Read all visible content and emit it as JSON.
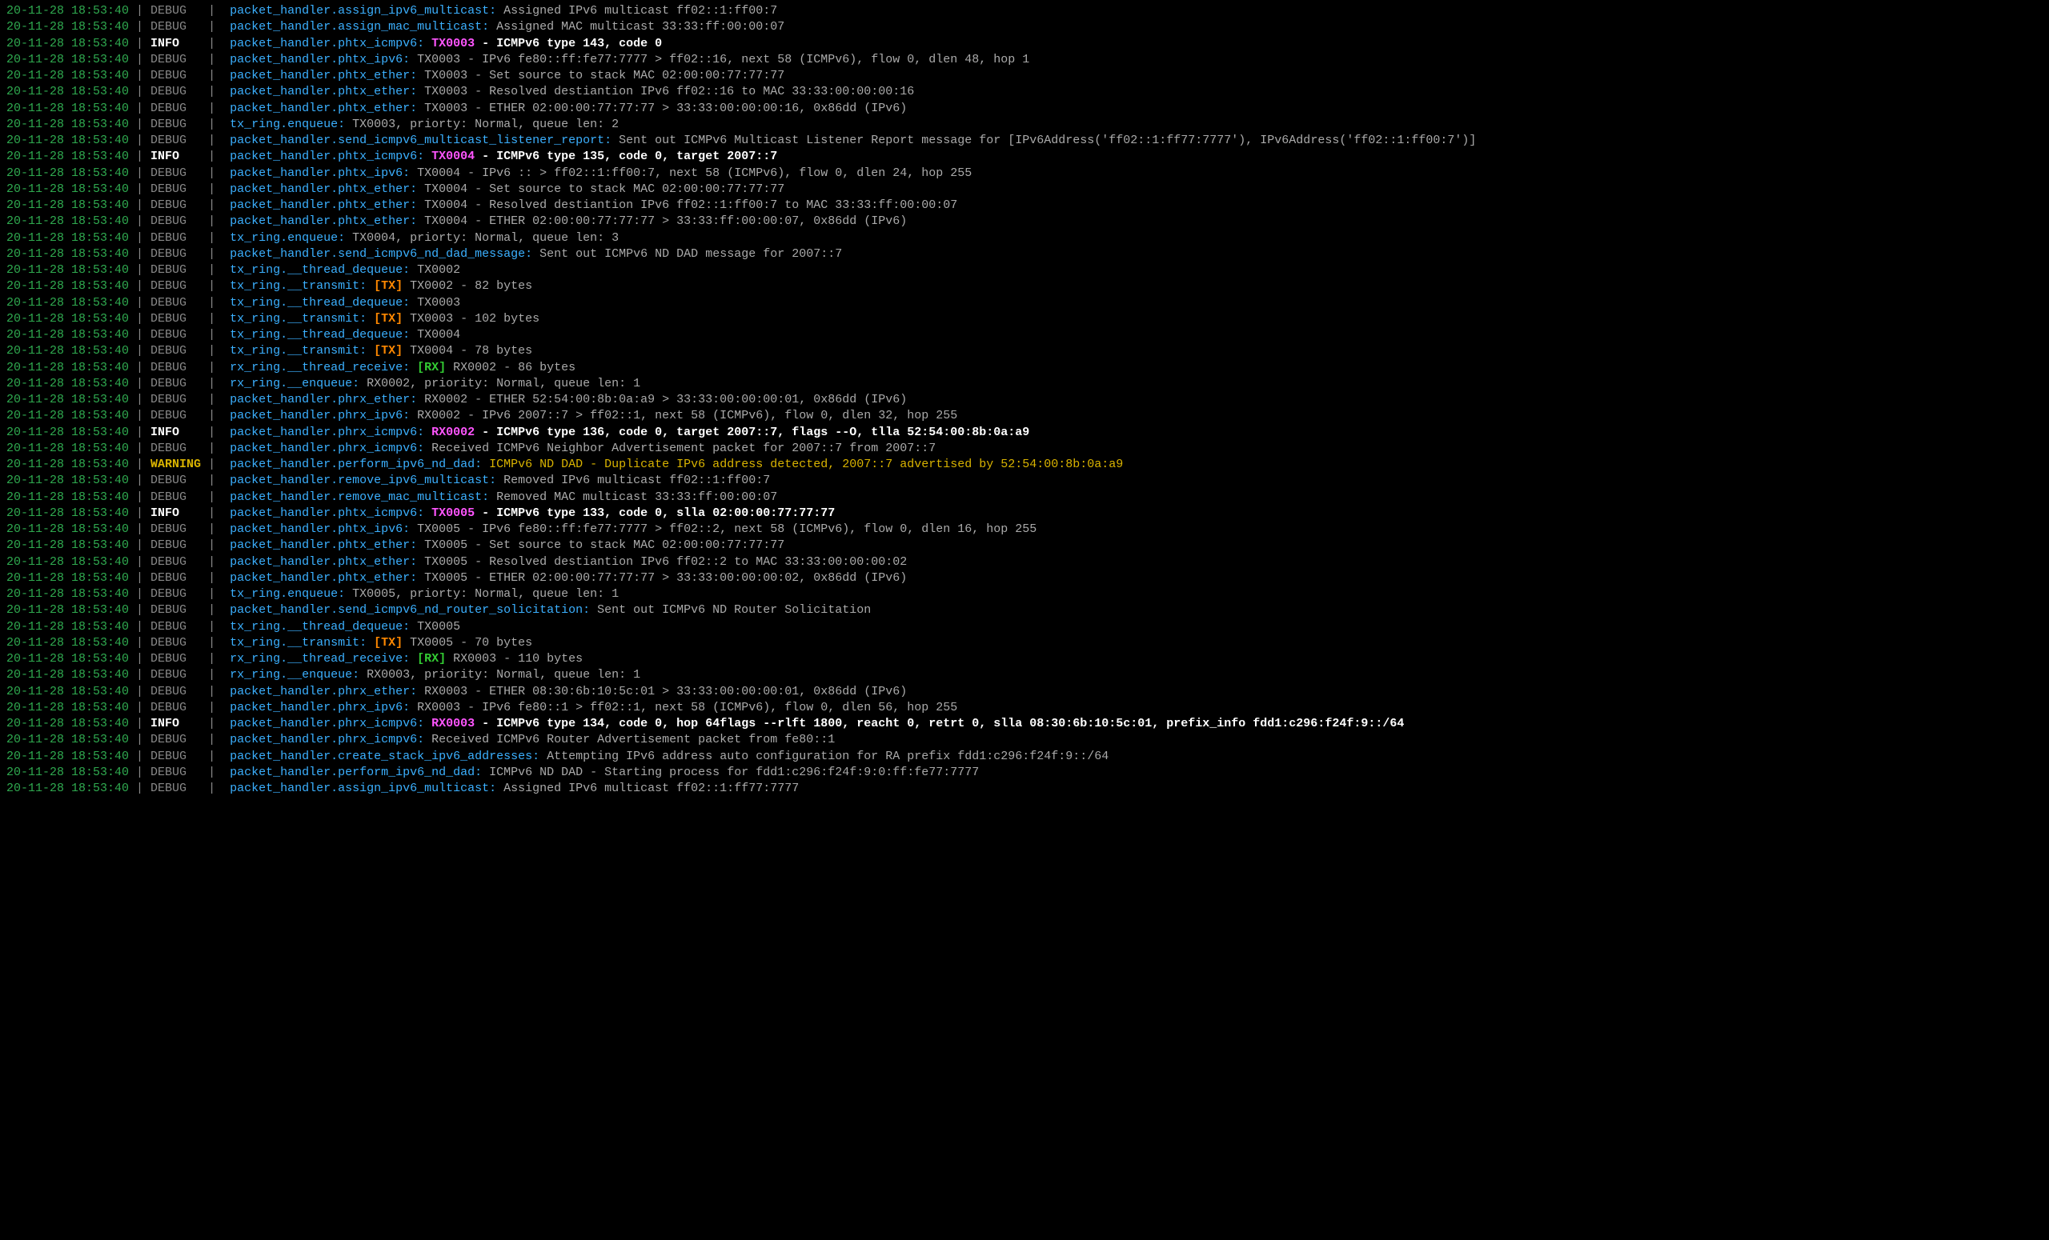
{
  "colors": {
    "timestamp": "#2fa94f",
    "separator": "#888888",
    "level_debug": "#888888",
    "level_info": "#ffffff",
    "level_warning": "#d9b300",
    "source": "#3bb0ff",
    "message": "#aaaaaa",
    "txid": "#ff55ff",
    "txtag": "#ff8800",
    "rxtag": "#33cc33",
    "background": "#000000"
  },
  "lines": [
    {
      "ts": "20-11-28 18:53:40",
      "level": "DEBUG",
      "src": "packet_handler.assign_ipv6_multicast:",
      "msg": "Assigned IPv6 multicast ff02::1:ff00:7"
    },
    {
      "ts": "20-11-28 18:53:40",
      "level": "DEBUG",
      "src": "packet_handler.assign_mac_multicast:",
      "msg": "Assigned MAC multicast 33:33:ff:00:00:07"
    },
    {
      "ts": "20-11-28 18:53:40",
      "level": "INFO",
      "src": "packet_handler.phtx_icmpv6:",
      "txid": "TX0003",
      "msg": " - ICMPv6 type 143, code 0"
    },
    {
      "ts": "20-11-28 18:53:40",
      "level": "DEBUG",
      "src": "packet_handler.phtx_ipv6:",
      "msg": "TX0003 - IPv6 fe80::ff:fe77:7777 > ff02::16, next 58 (ICMPv6), flow 0, dlen 48, hop 1"
    },
    {
      "ts": "20-11-28 18:53:40",
      "level": "DEBUG",
      "src": "packet_handler.phtx_ether:",
      "msg": "TX0003 - Set source to stack MAC 02:00:00:77:77:77"
    },
    {
      "ts": "20-11-28 18:53:40",
      "level": "DEBUG",
      "src": "packet_handler.phtx_ether:",
      "msg": "TX0003 - Resolved destiantion IPv6 ff02::16 to MAC 33:33:00:00:00:16"
    },
    {
      "ts": "20-11-28 18:53:40",
      "level": "DEBUG",
      "src": "packet_handler.phtx_ether:",
      "msg": "TX0003 - ETHER 02:00:00:77:77:77 > 33:33:00:00:00:16, 0x86dd (IPv6)"
    },
    {
      "ts": "20-11-28 18:53:40",
      "level": "DEBUG",
      "src": "tx_ring.enqueue:",
      "msg": "TX0003, priorty: Normal, queue len: 2"
    },
    {
      "ts": "20-11-28 18:53:40",
      "level": "DEBUG",
      "src": "packet_handler.send_icmpv6_multicast_listener_report:",
      "msg": "Sent out ICMPv6 Multicast Listener Report message for [IPv6Address('ff02::1:ff77:7777'), IPv6Address('ff02::1:ff00:7')]"
    },
    {
      "ts": "20-11-28 18:53:40",
      "level": "INFO",
      "src": "packet_handler.phtx_icmpv6:",
      "txid": "TX0004",
      "msg": " - ICMPv6 type 135, code 0, target 2007::7"
    },
    {
      "ts": "20-11-28 18:53:40",
      "level": "DEBUG",
      "src": "packet_handler.phtx_ipv6:",
      "msg": "TX0004 - IPv6 :: > ff02::1:ff00:7, next 58 (ICMPv6), flow 0, dlen 24, hop 255"
    },
    {
      "ts": "20-11-28 18:53:40",
      "level": "DEBUG",
      "src": "packet_handler.phtx_ether:",
      "msg": "TX0004 - Set source to stack MAC 02:00:00:77:77:77"
    },
    {
      "ts": "20-11-28 18:53:40",
      "level": "DEBUG",
      "src": "packet_handler.phtx_ether:",
      "msg": "TX0004 - Resolved destiantion IPv6 ff02::1:ff00:7 to MAC 33:33:ff:00:00:07"
    },
    {
      "ts": "20-11-28 18:53:40",
      "level": "DEBUG",
      "src": "packet_handler.phtx_ether:",
      "msg": "TX0004 - ETHER 02:00:00:77:77:77 > 33:33:ff:00:00:07, 0x86dd (IPv6)"
    },
    {
      "ts": "20-11-28 18:53:40",
      "level": "DEBUG",
      "src": "tx_ring.enqueue:",
      "msg": "TX0004, priorty: Normal, queue len: 3"
    },
    {
      "ts": "20-11-28 18:53:40",
      "level": "DEBUG",
      "src": "packet_handler.send_icmpv6_nd_dad_message:",
      "msg": "Sent out ICMPv6 ND DAD message for 2007::7"
    },
    {
      "ts": "20-11-28 18:53:40",
      "level": "DEBUG",
      "src": "tx_ring.__thread_dequeue:",
      "msg": "TX0002"
    },
    {
      "ts": "20-11-28 18:53:40",
      "level": "DEBUG",
      "src": "tx_ring.__transmit:",
      "txtag": "[TX]",
      "msg": " TX0002 - 82 bytes"
    },
    {
      "ts": "20-11-28 18:53:40",
      "level": "DEBUG",
      "src": "tx_ring.__thread_dequeue:",
      "msg": "TX0003"
    },
    {
      "ts": "20-11-28 18:53:40",
      "level": "DEBUG",
      "src": "tx_ring.__transmit:",
      "txtag": "[TX]",
      "msg": " TX0003 - 102 bytes"
    },
    {
      "ts": "20-11-28 18:53:40",
      "level": "DEBUG",
      "src": "tx_ring.__thread_dequeue:",
      "msg": "TX0004"
    },
    {
      "ts": "20-11-28 18:53:40",
      "level": "DEBUG",
      "src": "tx_ring.__transmit:",
      "txtag": "[TX]",
      "msg": " TX0004 - 78 bytes"
    },
    {
      "ts": "20-11-28 18:53:40",
      "level": "DEBUG",
      "src": "rx_ring.__thread_receive:",
      "rxtag": "[RX]",
      "msg": " RX0002 - 86 bytes"
    },
    {
      "ts": "20-11-28 18:53:40",
      "level": "DEBUG",
      "src": "rx_ring.__enqueue:",
      "msg": "RX0002, priority: Normal, queue len: 1"
    },
    {
      "ts": "20-11-28 18:53:40",
      "level": "DEBUG",
      "src": "packet_handler.phrx_ether:",
      "msg": "RX0002 - ETHER 52:54:00:8b:0a:a9 > 33:33:00:00:00:01, 0x86dd (IPv6)"
    },
    {
      "ts": "20-11-28 18:53:40",
      "level": "DEBUG",
      "src": "packet_handler.phrx_ipv6:",
      "msg": "RX0002 - IPv6 2007::7 > ff02::1, next 58 (ICMPv6), flow 0, dlen 32, hop 255"
    },
    {
      "ts": "20-11-28 18:53:40",
      "level": "INFO",
      "src": "packet_handler.phrx_icmpv6:",
      "txid": "RX0002",
      "msg": " - ICMPv6 type 136, code 0, target 2007::7, flags --O, tlla 52:54:00:8b:0a:a9"
    },
    {
      "ts": "20-11-28 18:53:40",
      "level": "DEBUG",
      "src": "packet_handler.phrx_icmpv6:",
      "msg": "Received ICMPv6 Neighbor Advertisement packet for 2007::7 from 2007::7"
    },
    {
      "ts": "20-11-28 18:53:40",
      "level": "WARNING",
      "src": "packet_handler.perform_ipv6_nd_dad:",
      "msg": "ICMPv6 ND DAD - Duplicate IPv6 address detected, 2007::7 advertised by 52:54:00:8b:0a:a9"
    },
    {
      "ts": "20-11-28 18:53:40",
      "level": "DEBUG",
      "src": "packet_handler.remove_ipv6_multicast:",
      "msg": "Removed IPv6 multicast ff02::1:ff00:7"
    },
    {
      "ts": "20-11-28 18:53:40",
      "level": "DEBUG",
      "src": "packet_handler.remove_mac_multicast:",
      "msg": "Removed MAC multicast 33:33:ff:00:00:07"
    },
    {
      "ts": "20-11-28 18:53:40",
      "level": "INFO",
      "src": "packet_handler.phtx_icmpv6:",
      "txid": "TX0005",
      "msg": " - ICMPv6 type 133, code 0, slla 02:00:00:77:77:77"
    },
    {
      "ts": "20-11-28 18:53:40",
      "level": "DEBUG",
      "src": "packet_handler.phtx_ipv6:",
      "msg": "TX0005 - IPv6 fe80::ff:fe77:7777 > ff02::2, next 58 (ICMPv6), flow 0, dlen 16, hop 255"
    },
    {
      "ts": "20-11-28 18:53:40",
      "level": "DEBUG",
      "src": "packet_handler.phtx_ether:",
      "msg": "TX0005 - Set source to stack MAC 02:00:00:77:77:77"
    },
    {
      "ts": "20-11-28 18:53:40",
      "level": "DEBUG",
      "src": "packet_handler.phtx_ether:",
      "msg": "TX0005 - Resolved destiantion IPv6 ff02::2 to MAC 33:33:00:00:00:02"
    },
    {
      "ts": "20-11-28 18:53:40",
      "level": "DEBUG",
      "src": "packet_handler.phtx_ether:",
      "msg": "TX0005 - ETHER 02:00:00:77:77:77 > 33:33:00:00:00:02, 0x86dd (IPv6)"
    },
    {
      "ts": "20-11-28 18:53:40",
      "level": "DEBUG",
      "src": "tx_ring.enqueue:",
      "msg": "TX0005, priorty: Normal, queue len: 1"
    },
    {
      "ts": "20-11-28 18:53:40",
      "level": "DEBUG",
      "src": "packet_handler.send_icmpv6_nd_router_solicitation:",
      "msg": "Sent out ICMPv6 ND Router Solicitation"
    },
    {
      "ts": "20-11-28 18:53:40",
      "level": "DEBUG",
      "src": "tx_ring.__thread_dequeue:",
      "msg": "TX0005"
    },
    {
      "ts": "20-11-28 18:53:40",
      "level": "DEBUG",
      "src": "tx_ring.__transmit:",
      "txtag": "[TX]",
      "msg": " TX0005 - 70 bytes"
    },
    {
      "ts": "20-11-28 18:53:40",
      "level": "DEBUG",
      "src": "rx_ring.__thread_receive:",
      "rxtag": "[RX]",
      "msg": " RX0003 - 110 bytes"
    },
    {
      "ts": "20-11-28 18:53:40",
      "level": "DEBUG",
      "src": "rx_ring.__enqueue:",
      "msg": "RX0003, priority: Normal, queue len: 1"
    },
    {
      "ts": "20-11-28 18:53:40",
      "level": "DEBUG",
      "src": "packet_handler.phrx_ether:",
      "msg": "RX0003 - ETHER 08:30:6b:10:5c:01 > 33:33:00:00:00:01, 0x86dd (IPv6)"
    },
    {
      "ts": "20-11-28 18:53:40",
      "level": "DEBUG",
      "src": "packet_handler.phrx_ipv6:",
      "msg": "RX0003 - IPv6 fe80::1 > ff02::1, next 58 (ICMPv6), flow 0, dlen 56, hop 255"
    },
    {
      "ts": "20-11-28 18:53:40",
      "level": "INFO",
      "src": "packet_handler.phrx_icmpv6:",
      "txid": "RX0003",
      "msg": " - ICMPv6 type 134, code 0, hop 64flags --rlft 1800, reacht 0, retrt 0, slla 08:30:6b:10:5c:01, prefix_info fdd1:c296:f24f:9::/64"
    },
    {
      "ts": "20-11-28 18:53:40",
      "level": "DEBUG",
      "src": "packet_handler.phrx_icmpv6:",
      "msg": "Received ICMPv6 Router Advertisement packet from fe80::1"
    },
    {
      "ts": "20-11-28 18:53:40",
      "level": "DEBUG",
      "src": "packet_handler.create_stack_ipv6_addresses:",
      "msg": "Attempting IPv6 address auto configuration for RA prefix fdd1:c296:f24f:9::/64"
    },
    {
      "ts": "20-11-28 18:53:40",
      "level": "DEBUG",
      "src": "packet_handler.perform_ipv6_nd_dad:",
      "msg": "ICMPv6 ND DAD - Starting process for fdd1:c296:f24f:9:0:ff:fe77:7777"
    },
    {
      "ts": "20-11-28 18:53:40",
      "level": "DEBUG",
      "src": "packet_handler.assign_ipv6_multicast:",
      "msg": "Assigned IPv6 multicast ff02::1:ff77:7777"
    }
  ]
}
